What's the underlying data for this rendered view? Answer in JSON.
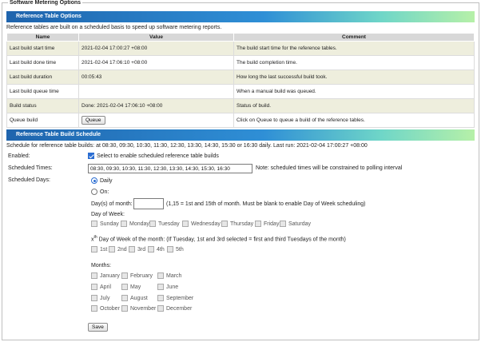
{
  "fieldset_title": "Software Metering Options",
  "options_section": {
    "title": "Reference Table Options",
    "description": "Reference tables are built on a scheduled basis to speed up software metering reports.",
    "columns": [
      "Name",
      "Value",
      "Comment"
    ],
    "rows": [
      {
        "name": "Last build start time",
        "value": "2021-02-04 17:00:27 +08:00",
        "comment": "The build start time for the reference tables."
      },
      {
        "name": "Last build done time",
        "value": "2021-02-04 17:06:10 +08:00",
        "comment": "The build completion time."
      },
      {
        "name": "Last build duration",
        "value": "00:05:43",
        "comment": "How long the last successful build took."
      },
      {
        "name": "Last build queue time",
        "value": "",
        "comment": "When a manual build was queued."
      },
      {
        "name": "Build status",
        "value": "Done: 2021-02-04 17:06:10 +08:00",
        "comment": "Status of build."
      },
      {
        "name": "Queue build",
        "value": "",
        "comment": "Click on Queue to queue a build of the reference tables."
      }
    ],
    "queue_button": "Queue"
  },
  "schedule_section": {
    "title": "Reference Table Build Schedule",
    "description": "Schedule for reference table builds: at 08:30, 09:30, 10:30, 11:30, 12:30, 13:30, 14:30, 15:30 or 16:30 daily. Last run: 2021-02-04 17:00:27 +08:00",
    "enabled_label": "Enabled:",
    "enabled_checkbox_label": "Select to enable scheduled reference table builds",
    "enabled_checked": true,
    "times_label": "Scheduled Times:",
    "times_value": "08:30, 09:30, 10:30, 11:30, 12:30, 13:30, 14:30, 15:30, 16:30",
    "times_note": "Note: scheduled times will be constrained to polling interval",
    "days_label": "Scheduled Days:",
    "daily_label": "Daily",
    "daily_selected": true,
    "on_label": "On:",
    "days_of_month_label": "Day(s) of month:",
    "days_of_month_value": "",
    "days_of_month_hint": "(1,15 = 1st and 15th of month. Must be blank to enable Day of Week scheduling)",
    "day_of_week_label": "Day of Week:",
    "weekdays": [
      "Sunday",
      "Monday",
      "Tuesday",
      "Wednesday",
      "Thursday",
      "Friday",
      "Saturday"
    ],
    "xth_prefix": "x",
    "xth_sup": "th",
    "xth_label": " Day of Week of the month: (If Tuesday, 1st and 3rd selected = first and third Tuesdays of the month)",
    "ordinals": [
      "1st",
      "2nd",
      "3rd",
      "4th",
      "5th"
    ],
    "months_label": "Months:",
    "months": [
      "January",
      "February",
      "March",
      "April",
      "May",
      "June",
      "July",
      "August",
      "September",
      "October",
      "November",
      "December"
    ],
    "save_button": "Save"
  }
}
